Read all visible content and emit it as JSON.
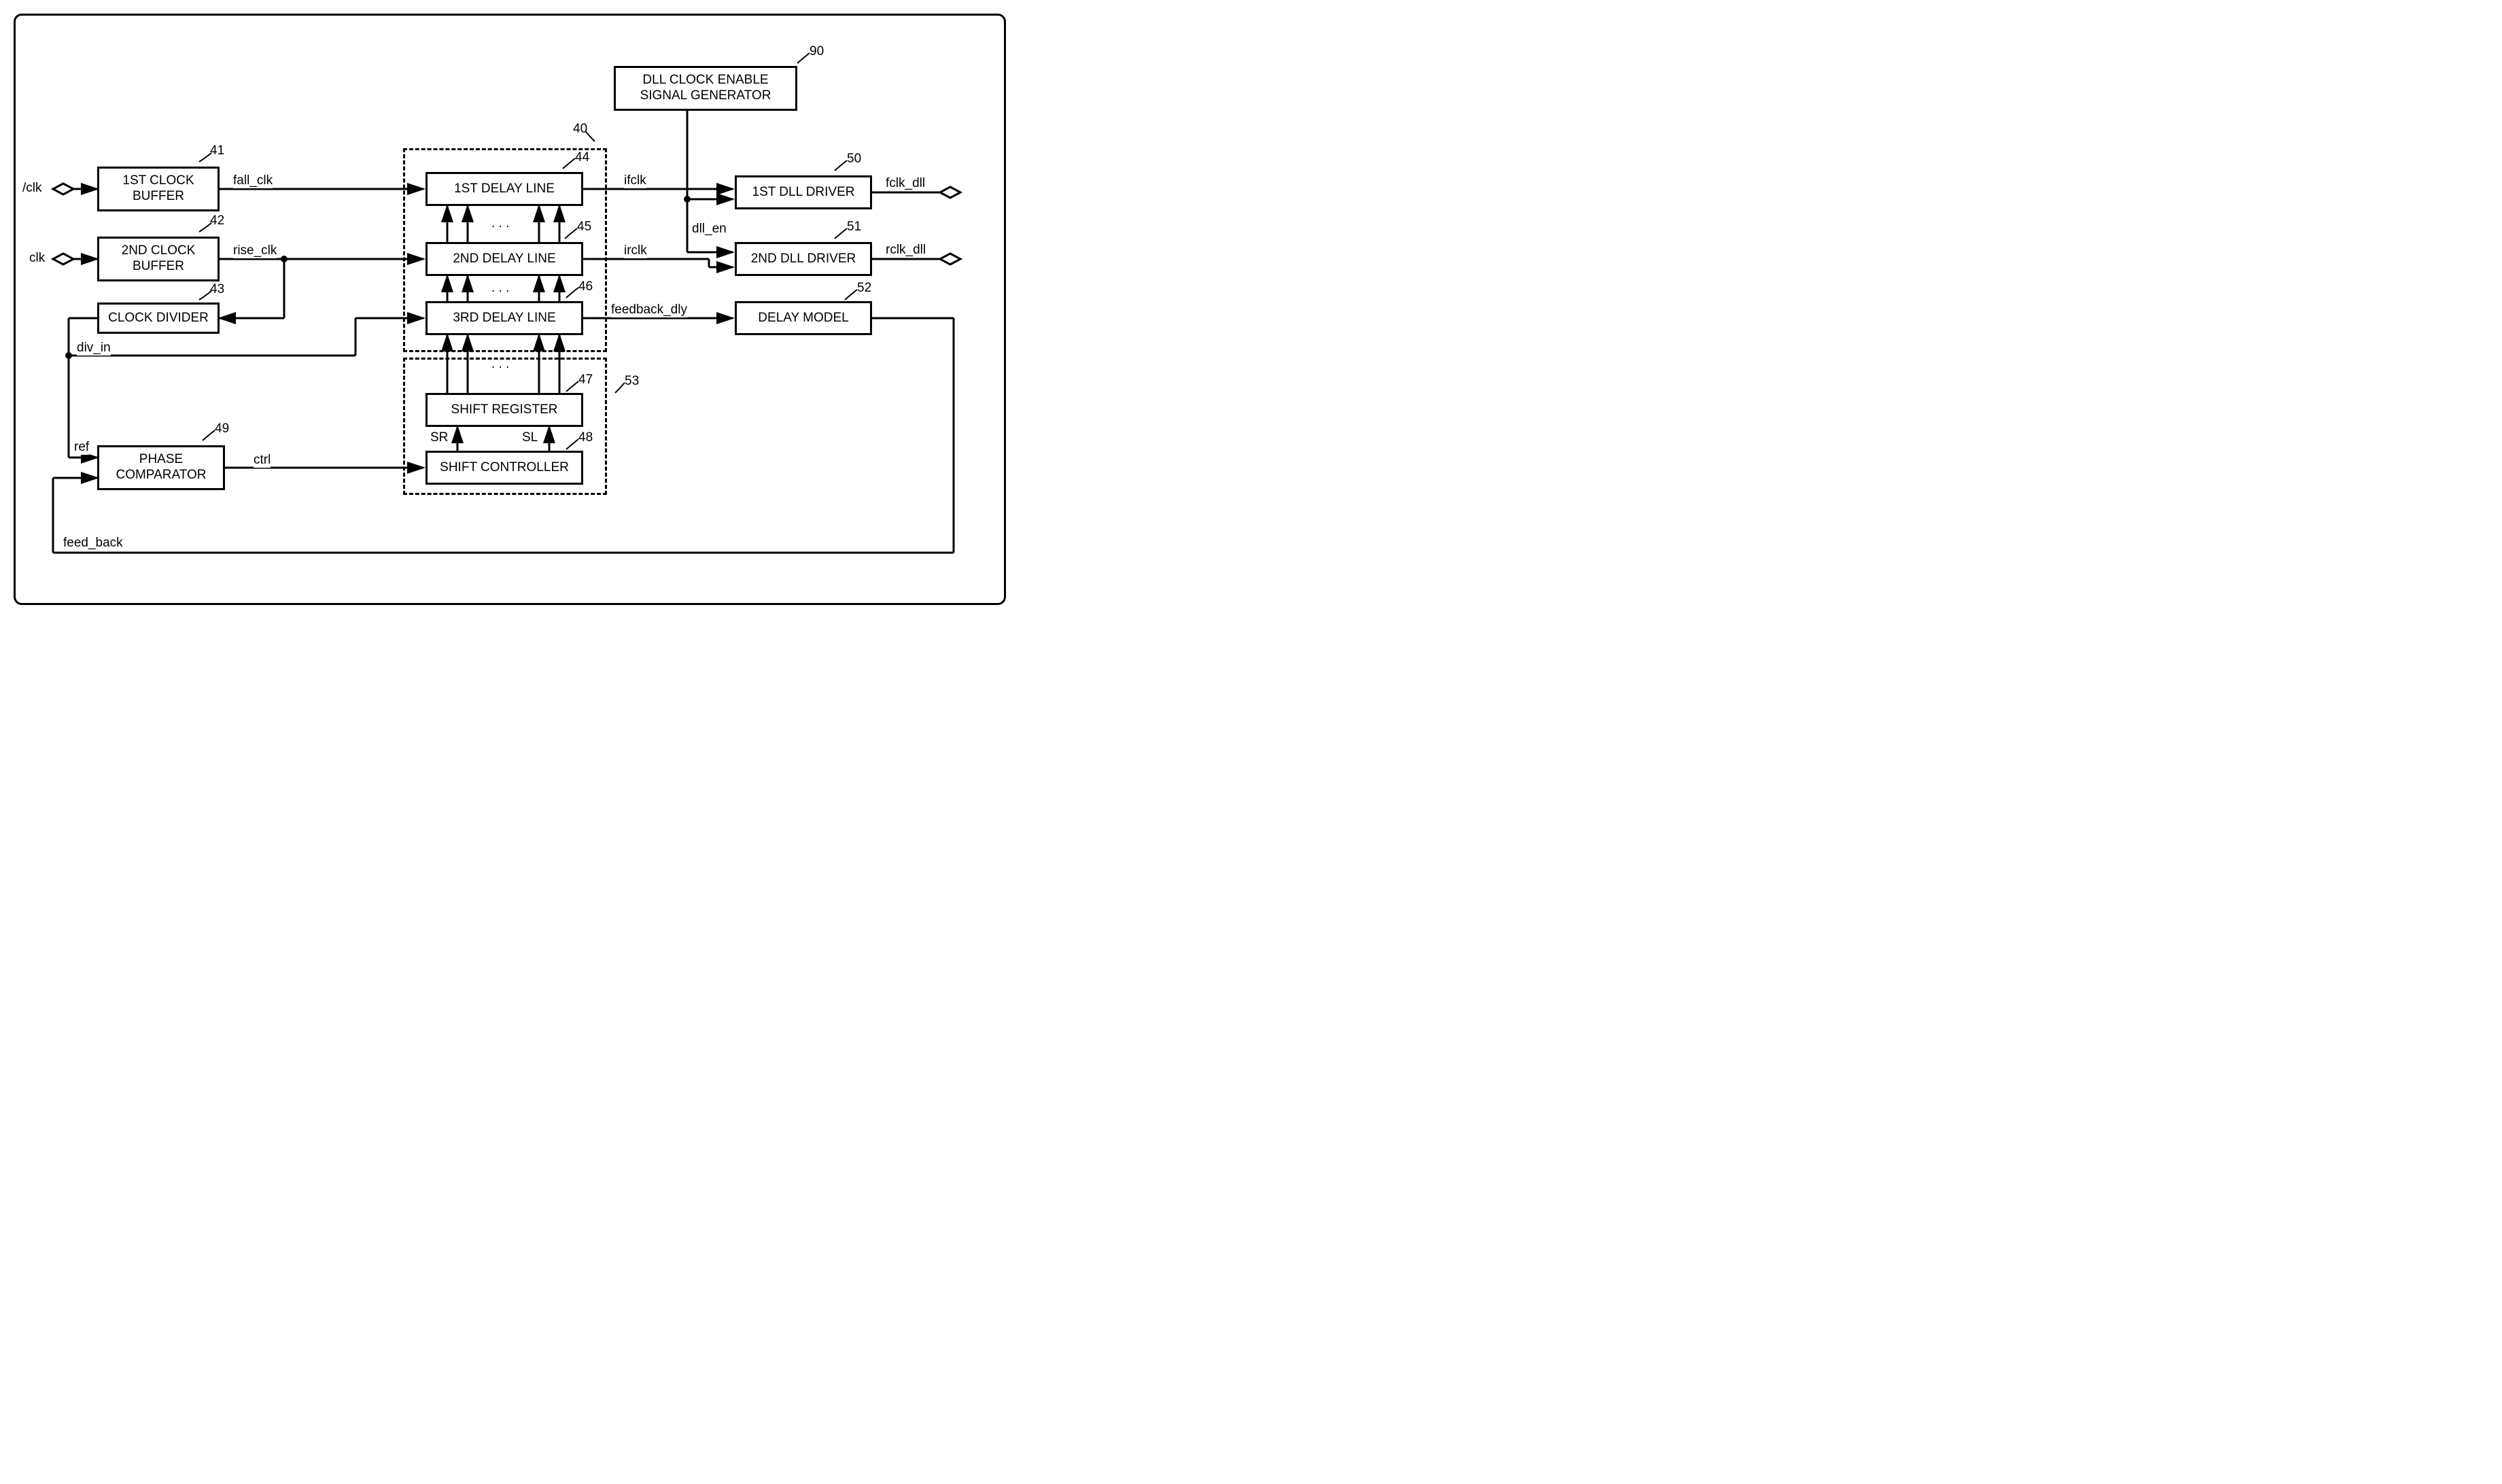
{
  "inputs": {
    "clk_n": "/clk",
    "clk": "clk"
  },
  "outputs": {
    "fclk_dll": "fclk_dll",
    "rclk_dll": "rclk_dll"
  },
  "blocks": {
    "buf1": "1ST CLOCK BUFFER",
    "buf2": "2ND CLOCK BUFFER",
    "clkdiv": "CLOCK DIVIDER",
    "phcomp": "PHASE COMPARATOR",
    "dl1": "1ST DELAY LINE",
    "dl2": "2ND DELAY LINE",
    "dl3": "3RD DELAY LINE",
    "shreg": "SHIFT REGISTER",
    "shctrl": "SHIFT CONTROLLER",
    "dllgen": "DLL CLOCK ENABLE SIGNAL GENERATOR",
    "drv1": "1ST DLL DRIVER",
    "drv2": "2ND DLL DRIVER",
    "dmodel": "DELAY MODEL"
  },
  "signals": {
    "fall_clk": "fall_clk",
    "rise_clk": "rise_clk",
    "div_in": "div_in",
    "ref": "ref",
    "ctrl": "ctrl",
    "sr": "SR",
    "sl": "SL",
    "ifclk": "ifclk",
    "irclk": "irclk",
    "dll_en": "dll_en",
    "feedback_dly": "feedback_dly",
    "feed_back": "feed_back"
  },
  "refs": {
    "r40": "40",
    "r41": "41",
    "r42": "42",
    "r43": "43",
    "r44": "44",
    "r45": "45",
    "r46": "46",
    "r47": "47",
    "r48": "48",
    "r49": "49",
    "r50": "50",
    "r51": "51",
    "r52": "52",
    "r53": "53",
    "r90": "90"
  },
  "dots": ". . ."
}
